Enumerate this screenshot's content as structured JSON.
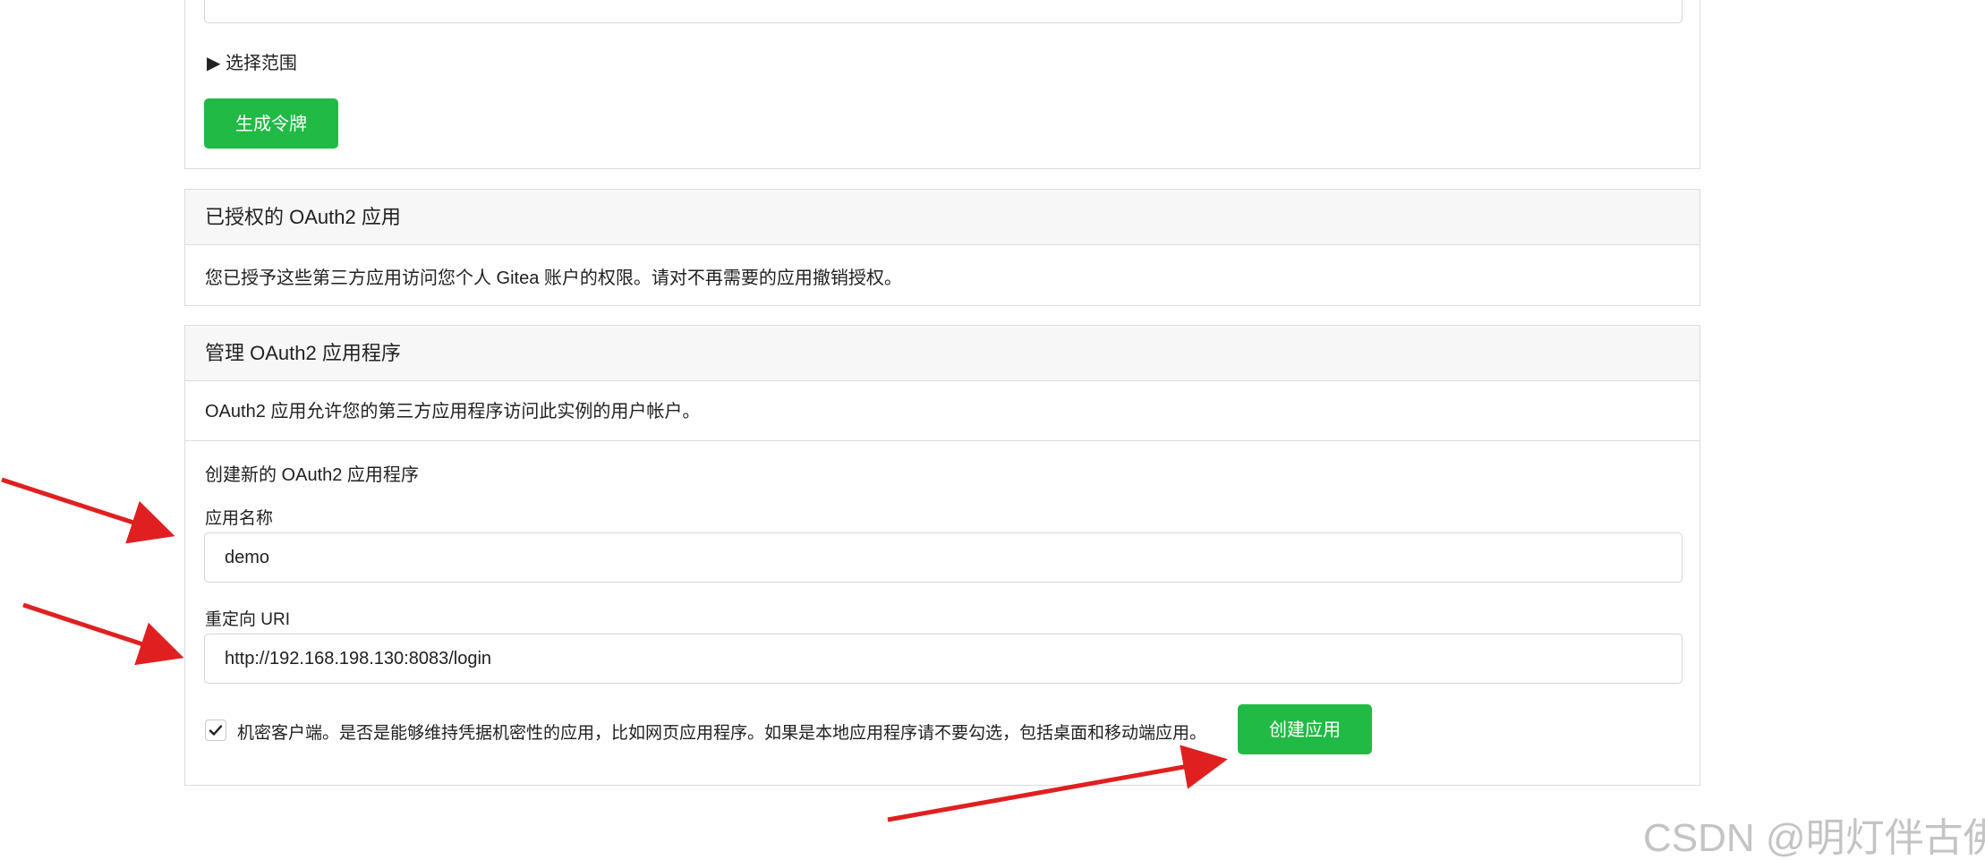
{
  "tokens": {
    "scope_toggle_label": "▶ 选择范围",
    "generate_button_label": "生成令牌"
  },
  "authorized_apps": {
    "title": "已授权的 OAuth2 应用",
    "description": "您已授予这些第三方应用访问您个人 Gitea 账户的权限。请对不再需要的应用撤销授权。"
  },
  "manage_apps": {
    "title": "管理 OAuth2 应用程序",
    "description": "OAuth2 应用允许您的第三方应用程序访问此实例的用户帐户。",
    "create_title": "创建新的 OAuth2 应用程序",
    "app_name_label": "应用名称",
    "app_name_value": "demo",
    "redirect_uri_label": "重定向 URI",
    "redirect_uri_value": "http://192.168.198.130:8083/login",
    "confidential_client_checked": true,
    "confidential_client_label": "机密客户端。是否是能够维持凭据机密性的应用，比如网页应用程序。如果是本地应用程序请不要勾选，包括桌面和移动端应用。",
    "create_button_label": "创建应用"
  },
  "annotations": {
    "arrow_color": "#e02020"
  },
  "watermark": "CSDN @明灯伴古佛",
  "colors": {
    "primary_green": "#21ba45",
    "header_bg": "#f7f7f7",
    "border": "#dcdcdc"
  }
}
